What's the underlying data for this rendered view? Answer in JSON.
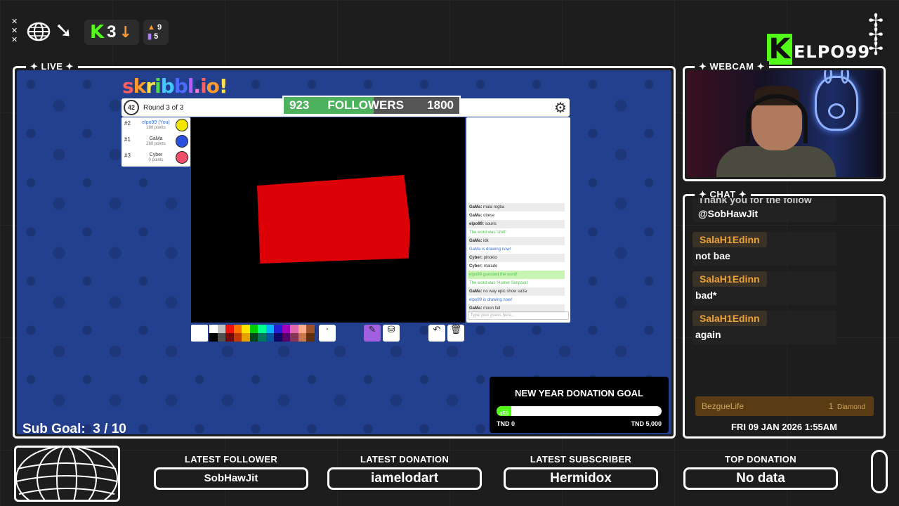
{
  "top_stats": {
    "kick_count": "3",
    "stat_a": "9",
    "stat_b": "5"
  },
  "brand": {
    "logo_letter": "K",
    "name": "ELPO99"
  },
  "panels": {
    "live_label": "LIVE",
    "webcam_label": "WEBCAM",
    "chat_label": "CHAT"
  },
  "game": {
    "logo": "skribbl.io",
    "round_text": "Round 3 of 3",
    "timer": "42",
    "followers": {
      "current": "923",
      "label": "FOLLOWERS",
      "goal": "1800",
      "progress": 0.51
    },
    "players": [
      {
        "rank": "#2",
        "name": "elpo99 (You)",
        "points": "190 points",
        "color": "#f2e600"
      },
      {
        "rank": "#1",
        "name": "GaMa",
        "points": "280 points",
        "color": "#2b50e0"
      },
      {
        "rank": "#3",
        "name": "Cyber",
        "points": "0 points",
        "color": "#f04d6a"
      }
    ],
    "chat": [
      {
        "user": "GaMa:",
        "text": "mala rogba",
        "style": ""
      },
      {
        "user": "GaMa:",
        "text": "obese",
        "style": ""
      },
      {
        "user": "elpo99:",
        "text": "souris",
        "style": ""
      },
      {
        "user": "",
        "text": "The word was 'shirt'",
        "style": "green"
      },
      {
        "user": "GaMa:",
        "text": "idk",
        "style": ""
      },
      {
        "user": "",
        "text": "GaMa is drawing now!",
        "style": "blue"
      },
      {
        "user": "Cyber:",
        "text": "pinokio",
        "style": ""
      },
      {
        "user": "Cyber:",
        "text": "malade",
        "style": ""
      },
      {
        "user": "",
        "text": "elpo99 guessed the word!",
        "style": "guess"
      },
      {
        "user": "",
        "text": "The word was 'Homer Simpson'",
        "style": "green"
      },
      {
        "user": "GaMa:",
        "text": "no way epic show sa3a",
        "style": ""
      },
      {
        "user": "",
        "text": "elpo99 is drawing now!",
        "style": "blue"
      },
      {
        "user": "GaMa:",
        "text": "moon fall",
        "style": ""
      }
    ],
    "guess_placeholder": "Type your guess here...",
    "palette": [
      "#ffffff",
      "#c1c1c1",
      "#ef130b",
      "#ff7100",
      "#ffe400",
      "#00cc00",
      "#00ff91",
      "#00b2ff",
      "#231fd3",
      "#a300ba",
      "#df69a7",
      "#ffac8e",
      "#a0522d",
      "#000000",
      "#505050",
      "#740b07",
      "#c23800",
      "#e8a200",
      "#004619",
      "#00785d",
      "#00569e",
      "#0e0865",
      "#550069",
      "#873554",
      "#cc774d",
      "#63300d"
    ]
  },
  "sub_goal": {
    "label": "Sub Goal:",
    "value": "3 / 10"
  },
  "donation_goal": {
    "title": "NEW YEAR DONATION GOAL",
    "current": "455",
    "progress": 0.091,
    "min": "TND 0",
    "max": "TND 5,000"
  },
  "stream_chat": {
    "partial_top": "Thank you for the follow",
    "messages": [
      {
        "user": "",
        "text": "@SobHawJit"
      },
      {
        "user": "SalaH1Edinn",
        "text": "not bae"
      },
      {
        "user": "SalaH1Edinn",
        "text": "bad*"
      },
      {
        "user": "SalaH1Edinn",
        "text": "again"
      }
    ],
    "diamond": {
      "user": "BezgueLife",
      "count": "1",
      "label": "Diamond"
    },
    "datetime": "FRI 09 JAN 2026 1:55AM"
  },
  "footer": {
    "latest_follower": {
      "title": "LATEST FOLLOWER",
      "value": "SobHawJit"
    },
    "latest_donation": {
      "title": "LATEST DONATION",
      "value": "iamelodart"
    },
    "latest_subscriber": {
      "title": "LATEST SUBSCRIBER",
      "value": "Hermidox"
    },
    "top_donation": {
      "title": "TOP DONATION",
      "value": "No data"
    }
  }
}
